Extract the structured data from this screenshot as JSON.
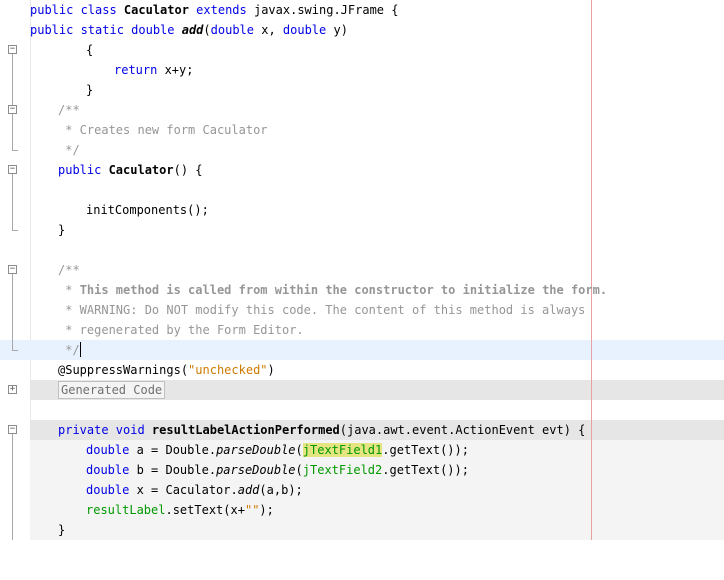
{
  "lines": {
    "l0": {
      "kw1": "public class ",
      "name": "Caculator",
      "kw2": " extends ",
      "rest": "javax.swing.JFrame {"
    },
    "l1": {
      "kw1": "public static double ",
      "name": "add",
      "p1": "(",
      "kw2": "double",
      "p2": " x, ",
      "kw3": "double",
      "p3": " y)"
    },
    "l2": {
      "text": "{"
    },
    "l3": {
      "kw": "return",
      "rest": " x+y;"
    },
    "l4": {
      "text": "}"
    },
    "l5": {
      "text": "/**"
    },
    "l6": {
      "text": " * Creates new form Caculator"
    },
    "l7": {
      "text": " */"
    },
    "l8": {
      "kw": "public ",
      "name": "Caculator",
      "rest": "() {"
    },
    "l9": {
      "text": ""
    },
    "l10": {
      "text": "initComponents();"
    },
    "l11": {
      "text": "}"
    },
    "l12": {
      "text": ""
    },
    "l13": {
      "text": "/**"
    },
    "l14": {
      "prefix": " * ",
      "bold": "This method is called from within the constructor to initialize the form."
    },
    "l15": {
      "text": " * WARNING: Do NOT modify this code. The content of this method is always"
    },
    "l16": {
      "text": " * regenerated by the Form Editor."
    },
    "l17": {
      "text": " */"
    },
    "l18": {
      "ann": "@SuppressWarnings(",
      "str": "\"unchecked\"",
      "close": ")"
    },
    "l19": {
      "text": "Generated Code"
    },
    "l20": {
      "text": ""
    },
    "l21": {
      "kw": "private void ",
      "name": "resultLabelActionPerformed",
      "rest": "(java.awt.event.ActionEvent evt) {"
    },
    "l22": {
      "kw": "double",
      "a": " a = Double.",
      "m": "parseDouble",
      "p": "(",
      "f": "jTextField1",
      "rest": ".getText());"
    },
    "l23": {
      "kw": "double",
      "a": " b = Double.",
      "m": "parseDouble",
      "p": "(",
      "f": "jTextField2",
      "rest": ".getText());"
    },
    "l24": {
      "kw": "double",
      "a": " x = Caculator.",
      "m": "add",
      "rest": "(a,b);"
    },
    "l25": {
      "f": "resultLabel",
      "a": ".setText(x+",
      "str": "\"\"",
      "rest": ");"
    },
    "l26": {
      "text": "}"
    }
  },
  "colors": {
    "keyword": "#0000e6",
    "comment": "#969696",
    "string": "#ce7b00",
    "field": "#009900",
    "current_line": "#e8f2fe",
    "shaded_line": "#e6e6e6"
  },
  "icons": {
    "collapse": "minus-box-icon",
    "expand": "plus-box-icon"
  }
}
